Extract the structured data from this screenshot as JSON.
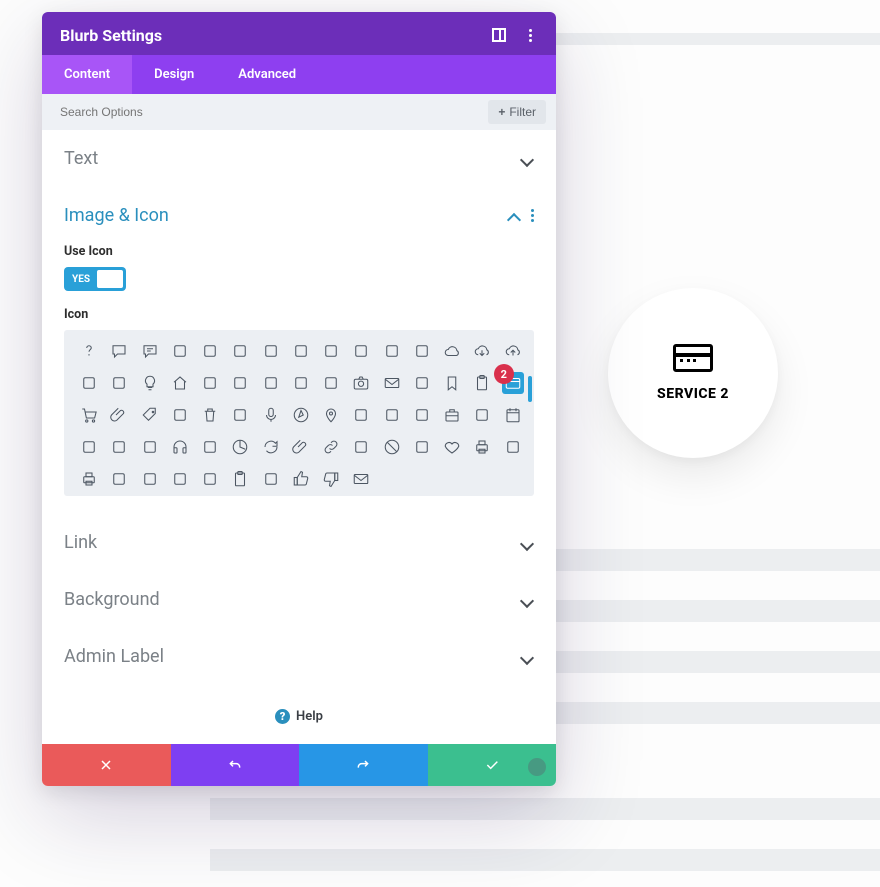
{
  "modal": {
    "title": "Blurb Settings",
    "tabs": [
      {
        "key": "content",
        "label": "Content",
        "active": true
      },
      {
        "key": "design",
        "label": "Design",
        "active": false
      },
      {
        "key": "advanced",
        "label": "Advanced",
        "active": false
      }
    ],
    "search": {
      "placeholder": "Search Options",
      "filter_label": "Filter"
    },
    "sections": {
      "text": {
        "title": "Text",
        "expanded": false
      },
      "image_icon": {
        "title": "Image & Icon",
        "expanded": true
      },
      "link": {
        "title": "Link",
        "expanded": false
      },
      "background": {
        "title": "Background",
        "expanded": false
      },
      "admin_label": {
        "title": "Admin Label",
        "expanded": false
      }
    },
    "image_icon_panel": {
      "use_icon_label": "Use Icon",
      "toggle_value": "YES",
      "icon_field_label": "Icon",
      "badge": "2",
      "selected_icon": "credit-card",
      "icons": [
        "question",
        "speech",
        "speech-lines",
        "vol-mute",
        "vol-low",
        "vol-high",
        "quote",
        "face-neutral",
        "clock",
        "padlock",
        "leaf",
        "guitar",
        "cloud",
        "cloud-down",
        "cloud-up",
        "sun",
        "image",
        "lightbulb",
        "house",
        "atom",
        "phone",
        "tablet",
        "laptop",
        "monitor",
        "camera-solid",
        "envelope",
        "cone",
        "bookmark",
        "blank1",
        "blank2",
        "clipboard",
        "credit-card",
        "shopping-cart",
        "paperclip",
        "tag",
        "marker",
        "trash",
        "cursor",
        "microphone",
        "compass-pin",
        "location-pin",
        "pushpin",
        "map",
        "map-fold",
        "blank3",
        "briefcase",
        "page",
        "calendar",
        "grid3",
        "grid4",
        "barcode",
        "headphones",
        "life-ring",
        "pie",
        "refresh",
        "attach",
        "link",
        "spinner",
        "no-entry",
        "blank4",
        "card2",
        "heart",
        "printer",
        "calculator",
        "print2",
        "save",
        "tray",
        "id",
        "id-card",
        "clipboard2",
        "clip-doc",
        "thumbs-up",
        "thumbs-down",
        "mail",
        "blank5"
      ]
    },
    "help_label": "Help"
  },
  "preview": {
    "icon": "credit-card",
    "title": "SERVICE 2"
  },
  "colors": {
    "header": "#6c2eb9",
    "tabbar": "#8e3ff0",
    "tab_active": "#a855f7",
    "accent_blue": "#29a0d8",
    "link_blue": "#2a8fbd",
    "danger": "#d9304c"
  }
}
